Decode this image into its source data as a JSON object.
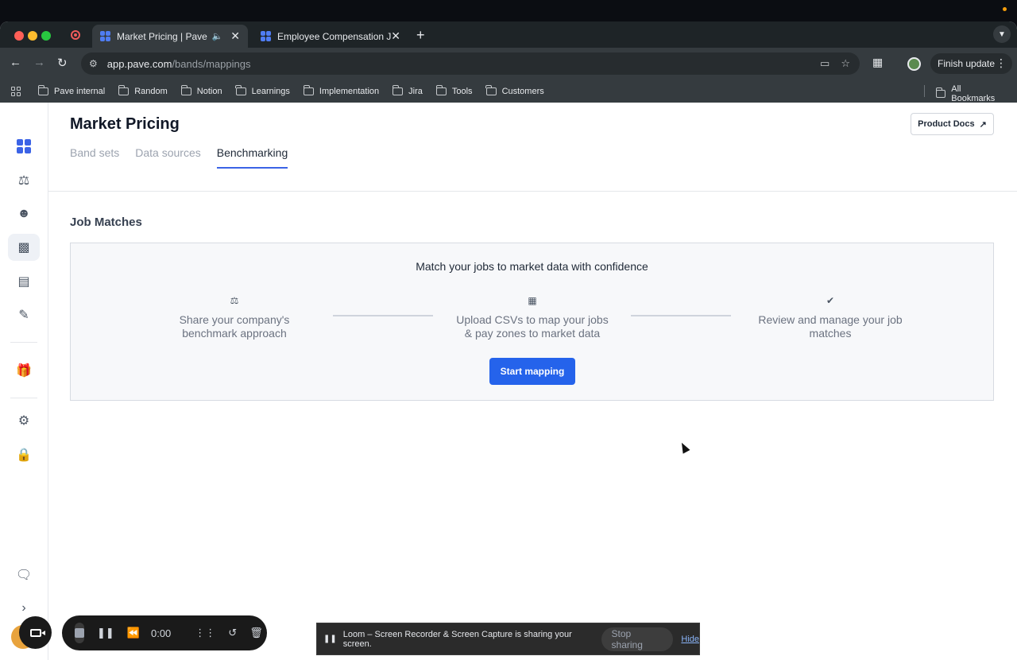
{
  "browser": {
    "tabs": [
      {
        "title": "Market Pricing | Pave",
        "active": true
      },
      {
        "title": "Employee Compensation Job",
        "active": false
      }
    ],
    "url_host": "app.pave.com",
    "url_path": "/bands/mappings",
    "finish_update": "Finish update",
    "bookmarks": [
      "Pave internal",
      "Random",
      "Notion",
      "Learnings",
      "Implementation",
      "Jira",
      "Tools",
      "Customers"
    ],
    "all_bookmarks": "All Bookmarks"
  },
  "page": {
    "title": "Market Pricing",
    "product_docs": "Product Docs",
    "tabs": [
      "Band sets",
      "Data sources",
      "Benchmarking"
    ],
    "selected_tab": "Benchmarking",
    "section_title": "Job Matches",
    "panel": {
      "heading": "Match your jobs to market data with confidence",
      "steps": [
        {
          "icon": "scale-icon",
          "text": "Share your company's benchmark approach"
        },
        {
          "icon": "map-icon",
          "text": "Upload CSVs to map your jobs & pay zones to market data"
        },
        {
          "icon": "check-badge-icon",
          "text": "Review and manage your job matches"
        }
      ],
      "button": "Start mapping"
    }
  },
  "loom": {
    "time": "0:00",
    "share_message": "Loom – Screen Recorder & Screen Capture is sharing your screen.",
    "stop_sharing": "Stop sharing",
    "hide": "Hide"
  },
  "colors": {
    "accent": "#2563eb",
    "tab_underline": "#3b63e6",
    "chrome_bg": "#353b3f"
  }
}
